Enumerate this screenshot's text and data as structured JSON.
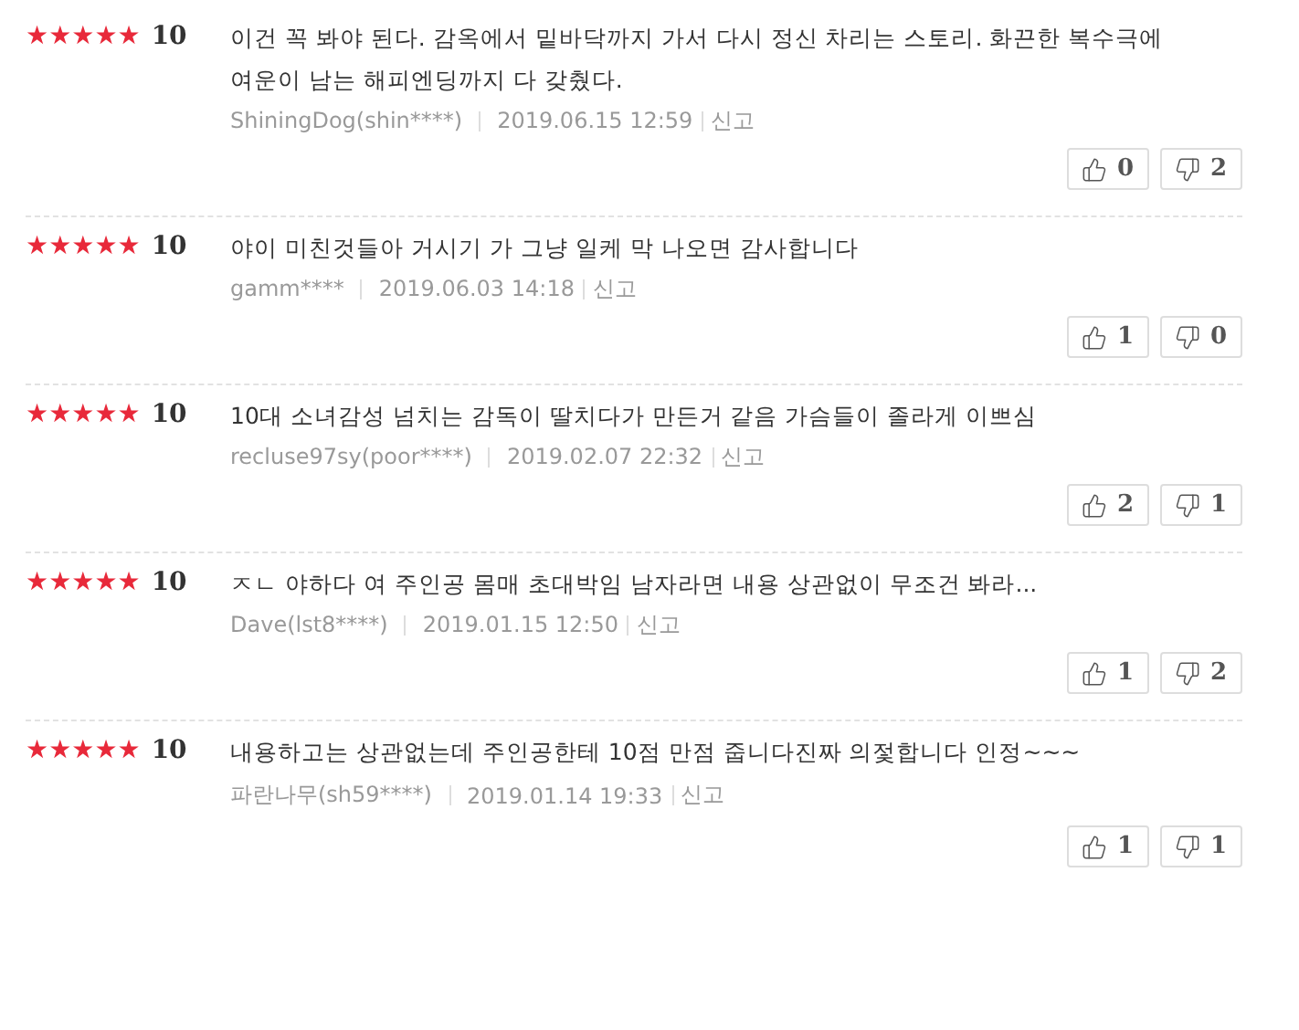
{
  "reviews": [
    {
      "stars": 5,
      "score": "10",
      "text": "이건 꼭 봐야 된다. 감옥에서 밑바닥까지 가서 다시 정신 차리는 스토리. 화끈한 복수극에 여운이 남는 해피엔딩까지 다 갖췄다.",
      "author": "ShiningDog(shin****)",
      "date": "2019.06.15 12:59",
      "report": "신고",
      "likes": "0",
      "dislikes": "2"
    },
    {
      "stars": 5,
      "score": "10",
      "text": "야이 미친것들아 거시기 가 그냥 일케 막 나오면 감사합니다",
      "author": "gamm****",
      "date": "2019.06.03 14:18",
      "report": "신고",
      "likes": "1",
      "dislikes": "0"
    },
    {
      "stars": 5,
      "score": "10",
      "text": "10대 소녀감성 넘치는 감독이 딸치다가 만든거 같음 가슴들이 졸라게 이쁘심",
      "author": "recluse97sy(poor****)",
      "date": "2019.02.07 22:32",
      "report": "신고",
      "likes": "2",
      "dislikes": "1"
    },
    {
      "stars": 5,
      "score": "10",
      "text": "ㅈㄴ 야하다 여 주인공 몸매 초대박임 남자라면 내용 상관없이 무조건 봐라...",
      "author": "Dave(lst8****)",
      "date": "2019.01.15 12:50",
      "report": "신고",
      "likes": "1",
      "dislikes": "2"
    },
    {
      "stars": 5,
      "score": "10",
      "text": "내용하고는 상관없는데 주인공한테 10점 만점 줍니다진짜 의젗합니다 인정~~~",
      "author": "파란나무(sh59****)",
      "date": "2019.01.14 19:33",
      "report": "신고",
      "likes": "1",
      "dislikes": "1"
    }
  ]
}
